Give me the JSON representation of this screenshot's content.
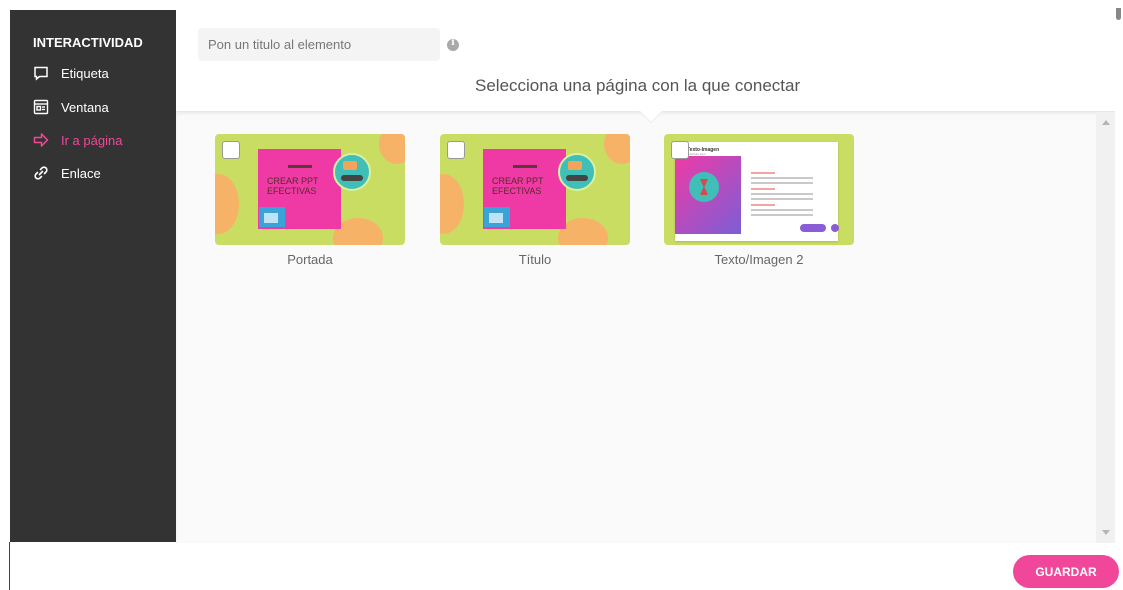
{
  "sidebar": {
    "title": "INTERACTIVIDAD",
    "items": [
      {
        "label": "Etiqueta",
        "icon": "comment-icon",
        "active": false
      },
      {
        "label": "Ventana",
        "icon": "window-icon",
        "active": false
      },
      {
        "label": "Ir a página",
        "icon": "arrow-right-icon",
        "active": true
      },
      {
        "label": "Enlace",
        "icon": "link-icon",
        "active": false
      }
    ]
  },
  "header": {
    "title_placeholder": "Pon un titulo al elemento",
    "instruction": "Selecciona una página con la que conectar"
  },
  "pages": [
    {
      "label": "Portada",
      "slide_text": "CREAR PPT EFECTIVAS"
    },
    {
      "label": "Título",
      "slide_text": "CREAR PPT EFECTIVAS"
    },
    {
      "label": "Texto/Imagen 2",
      "slide_title": "Texto-Imagen",
      "slide_subtitle": "Subtítulo aquí"
    }
  ],
  "footer": {
    "save_label": "GUARDAR"
  },
  "colors": {
    "accent": "#f0479b",
    "sidebar_bg": "#333333",
    "thumb_bg": "#c9dd63"
  }
}
